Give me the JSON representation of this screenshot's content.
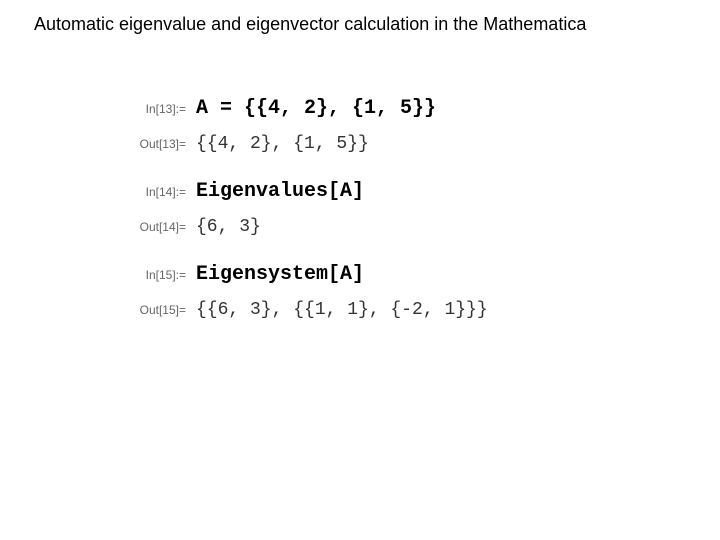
{
  "title": "Automatic eigenvalue and eigenvector calculation in the Mathematica",
  "cells": [
    {
      "label": "In[13]:=",
      "content": "A = {{4, 2}, {1, 5}}",
      "kind": "in"
    },
    {
      "label": "Out[13]=",
      "content": "{{4, 2}, {1, 5}}",
      "kind": "out"
    },
    {
      "label": "In[14]:=",
      "content": "Eigenvalues[A]",
      "kind": "in"
    },
    {
      "label": "Out[14]=",
      "content": "{6, 3}",
      "kind": "out"
    },
    {
      "label": "In[15]:=",
      "content": "Eigensystem[A]",
      "kind": "in"
    },
    {
      "label": "Out[15]=",
      "content": "{{6, 3}, {{1, 1}, {-2, 1}}}",
      "kind": "out"
    }
  ]
}
